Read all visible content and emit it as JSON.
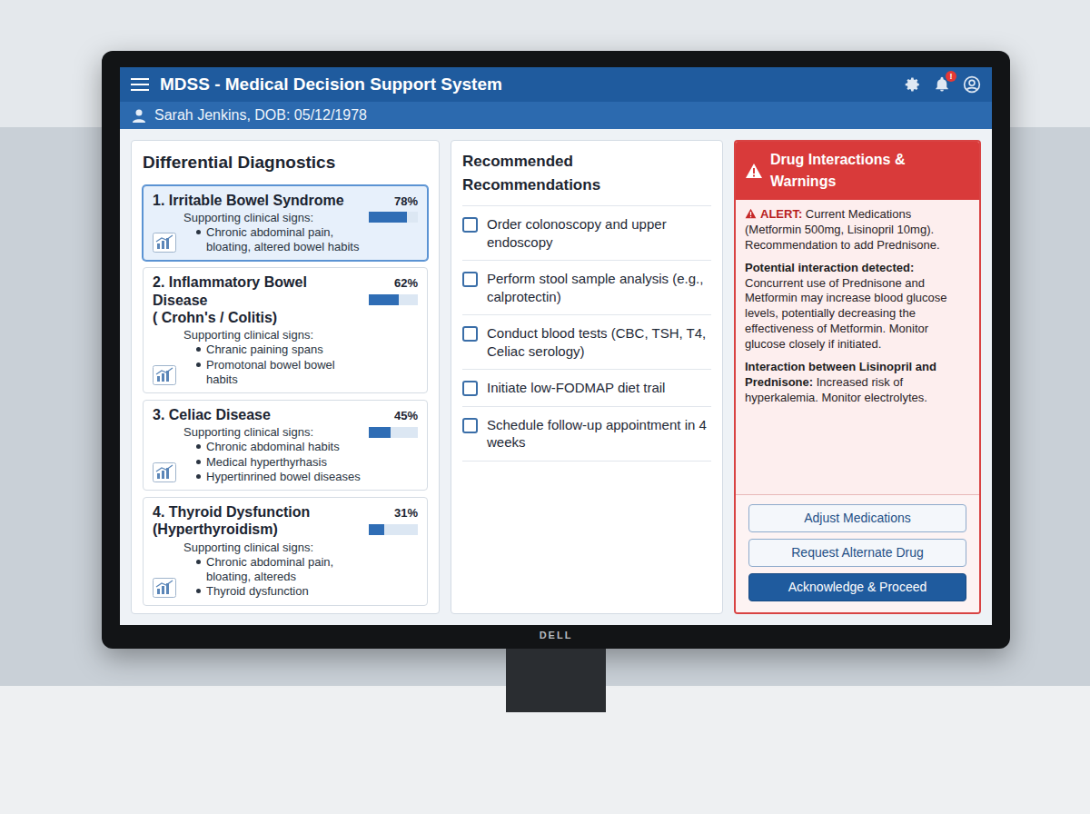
{
  "header": {
    "title": "MDSS - Medical Decision Support System",
    "notification_badge": "!"
  },
  "patient": {
    "label": "Sarah Jenkins, DOB: 05/12/1978"
  },
  "differential": {
    "title": "Differential Diagnostics",
    "items": [
      {
        "name": [
          "1. Irritable Bowel Syndrome"
        ],
        "percent": "78%",
        "level": 0.78,
        "signs_label": "Supporting clinical signs:",
        "signs": [
          "Chronic abdominal pain, bloating, altered bowel habits"
        ],
        "selected": true
      },
      {
        "name": [
          "2. Inflammatory Bowel Disease",
          "( Crohn's / Colitis)"
        ],
        "percent": "62%",
        "level": 0.62,
        "signs_label": "Supporting clinical signs:",
        "signs": [
          "Chranic paining spans",
          "Promotonal bowel bowel habits"
        ],
        "selected": false
      },
      {
        "name": [
          "3. Celiac Disease"
        ],
        "percent": "45%",
        "level": 0.45,
        "signs_label": "Supporting clinical signs:",
        "signs": [
          "Chronic abdominal habits",
          "Medical hyperthyrhasis",
          "Hypertinrined bowel diseases"
        ],
        "selected": false
      },
      {
        "name": [
          "4. Thyroid Dysfunction",
          "(Hyperthyroidism)"
        ],
        "percent": "31%",
        "level": 0.31,
        "signs_label": "Supporting clinical signs:",
        "signs": [
          "Chronic abdominal pain, bloating, altereds",
          "Thyroid dysfunction"
        ],
        "selected": false
      }
    ]
  },
  "recommendations": {
    "title": "Recommended Recommendations",
    "items": [
      {
        "label": "Order colonoscopy and upper endoscopy",
        "checked": false
      },
      {
        "label": "Perform stool sample analysis (e.g., calprotectin)",
        "checked": false
      },
      {
        "label": "Conduct blood tests (CBC, TSH, T4, Celiac serology)",
        "checked": false
      },
      {
        "label": "Initiate low-FODMAP diet trail",
        "checked": false
      },
      {
        "label": "Schedule follow-up appointment in 4 weeks",
        "checked": false
      }
    ]
  },
  "warnings": {
    "title": "Drug Interactions & Warnings",
    "alert": {
      "label": "ALERT:",
      "text": "Current Medications (Metformin 500mg, Lisinopril 10mg). Recommendation to add Prednisone."
    },
    "sections": [
      {
        "heading": "Potential interaction detected:",
        "text": "Concurrent use of Prednisone and Metformin may increase blood glucose levels, potentially decreasing the effectiveness of Metformin. Monitor glucose closely if initiated."
      },
      {
        "heading": "Interaction between Lisinopril and Prednisone:",
        "text": "Increased risk of hyperkalemia. Monitor electrolytes."
      }
    ],
    "buttons": [
      {
        "label": "Adjust Medications",
        "kind": "secondary"
      },
      {
        "label": "Request Alternate Drug",
        "kind": "secondary"
      },
      {
        "label": "Acknowledge & Proceed",
        "kind": "primary"
      }
    ]
  },
  "monitor": {
    "brand": "DELL"
  }
}
